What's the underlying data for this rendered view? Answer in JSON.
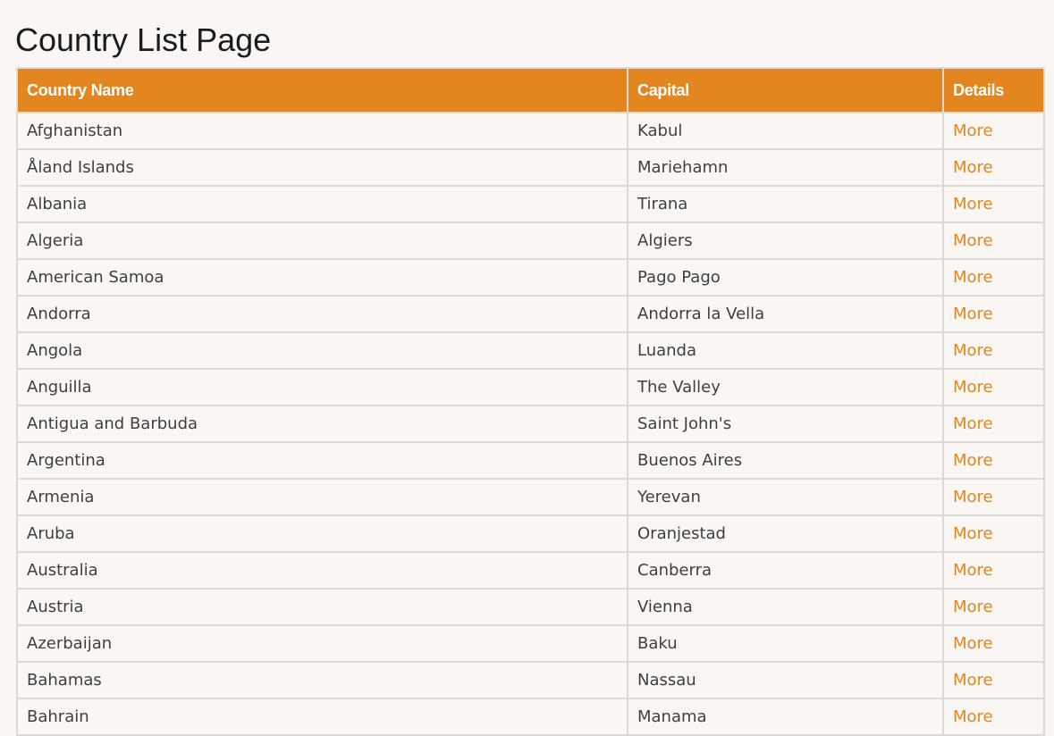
{
  "page": {
    "title": "Country List Page"
  },
  "table": {
    "headers": {
      "country": "Country Name",
      "capital": "Capital",
      "details": "Details"
    },
    "rows": [
      {
        "country": "Afghanistan",
        "capital": "Kabul",
        "details": "More"
      },
      {
        "country": "Åland Islands",
        "capital": "Mariehamn",
        "details": "More"
      },
      {
        "country": "Albania",
        "capital": "Tirana",
        "details": "More"
      },
      {
        "country": "Algeria",
        "capital": "Algiers",
        "details": "More"
      },
      {
        "country": "American Samoa",
        "capital": "Pago Pago",
        "details": "More"
      },
      {
        "country": "Andorra",
        "capital": "Andorra la Vella",
        "details": "More"
      },
      {
        "country": "Angola",
        "capital": "Luanda",
        "details": "More"
      },
      {
        "country": "Anguilla",
        "capital": "The Valley",
        "details": "More"
      },
      {
        "country": "Antigua and Barbuda",
        "capital": "Saint John's",
        "details": "More"
      },
      {
        "country": "Argentina",
        "capital": "Buenos Aires",
        "details": "More"
      },
      {
        "country": "Armenia",
        "capital": "Yerevan",
        "details": "More"
      },
      {
        "country": "Aruba",
        "capital": "Oranjestad",
        "details": "More"
      },
      {
        "country": "Australia",
        "capital": "Canberra",
        "details": "More"
      },
      {
        "country": "Austria",
        "capital": "Vienna",
        "details": "More"
      },
      {
        "country": "Azerbaijan",
        "capital": "Baku",
        "details": "More"
      },
      {
        "country": "Bahamas",
        "capital": "Nassau",
        "details": "More"
      },
      {
        "country": "Bahrain",
        "capital": "Manama",
        "details": "More"
      }
    ]
  },
  "colors": {
    "accent": "#e3861f",
    "background": "#f9f6f3",
    "text": "#3f3f3f",
    "border": "#dcd8d3"
  }
}
